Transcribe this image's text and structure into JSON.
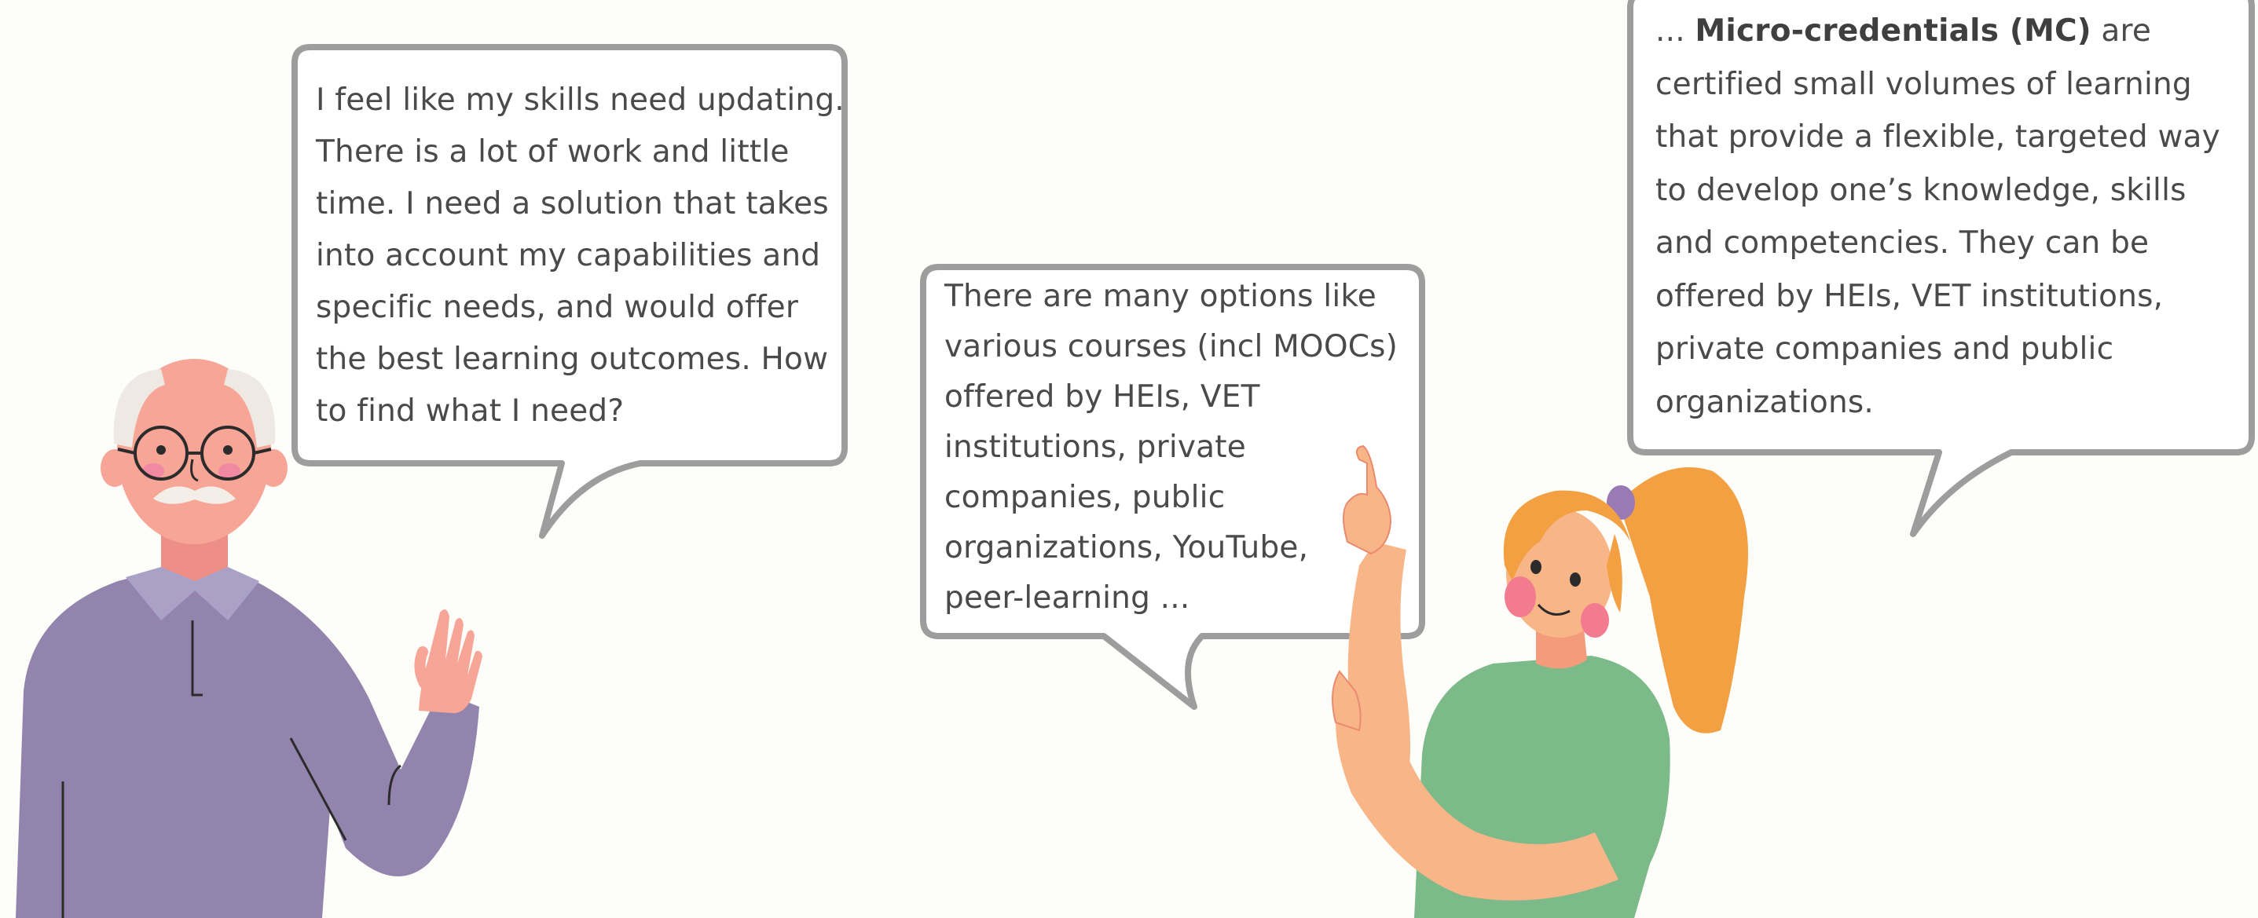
{
  "colors": {
    "background": "#fdfdf9",
    "bubble_border": "#9d9d9d",
    "bubble_fill": "#ffffff",
    "text": "#4a4a4a",
    "man_sweater": "#9384ae",
    "man_skin": "#f6a597",
    "woman_shirt": "#7cba8a",
    "woman_hair": "#f3a042",
    "woman_skin": "#f8b688"
  },
  "bubbles": {
    "man": {
      "lines": [
        "I feel like my skills need updating.",
        "There is a lot of work and little",
        "time. I need a solution that takes",
        "into account my capabilities and",
        "specific needs, and would offer",
        "the best learning outcomes. How",
        "to find what I need?"
      ]
    },
    "options": {
      "lines": [
        "There are many options like",
        "various courses (incl MOOCs)",
        "offered by HEIs, VET",
        "institutions, private",
        "companies, public",
        "organizations, YouTube,",
        "peer-learning ..."
      ]
    },
    "micro": {
      "lead": "... ",
      "term": "Micro-credentials (MC)",
      "first_line_rest": " are",
      "lines": [
        "certified small volumes of learning",
        "that provide a flexible, targeted way",
        "to develop one’s knowledge, skills",
        "and competencies. They can be",
        "offered by HEIs, VET institutions,",
        "private companies and public",
        "organizations."
      ]
    }
  },
  "icons": {
    "man": "elderly-man-waving-icon",
    "woman": "woman-pointing-up-icon"
  }
}
